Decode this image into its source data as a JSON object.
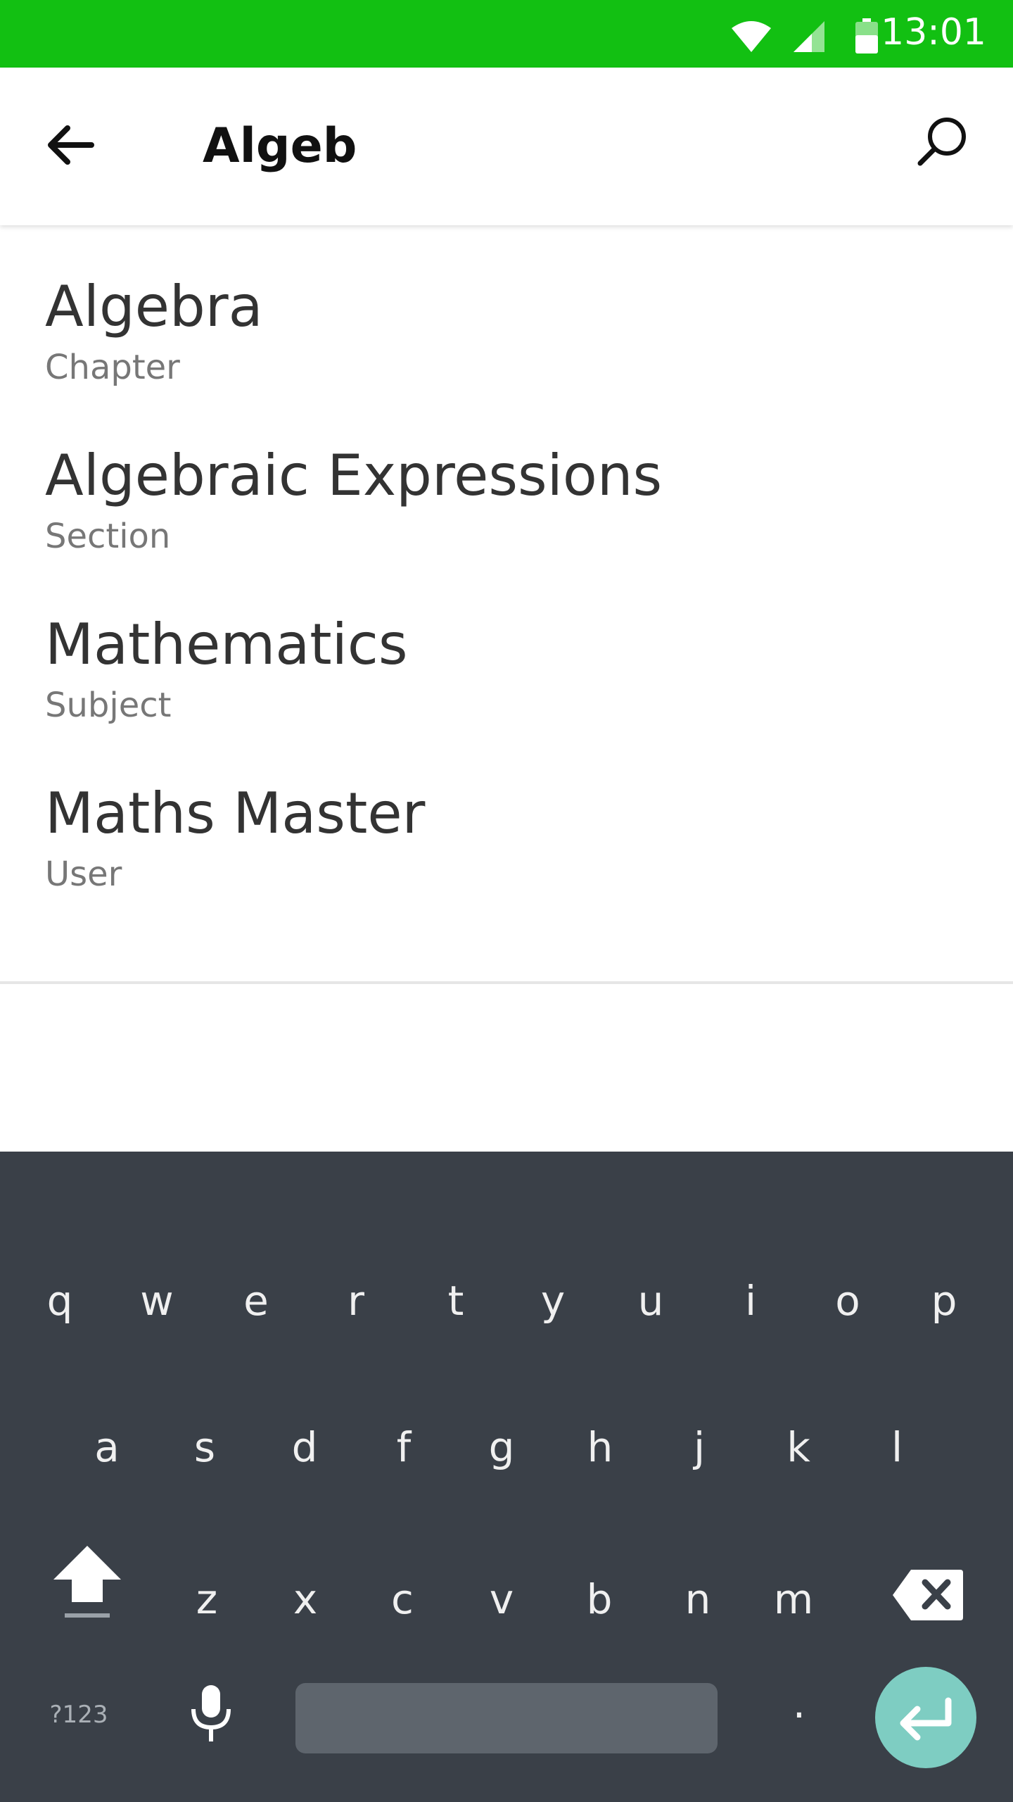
{
  "status_bar": {
    "time": "13:01",
    "background_color": "#12c012",
    "icons": [
      "wifi-icon",
      "cell-signal-icon",
      "battery-icon"
    ]
  },
  "toolbar": {
    "query": "Algeb",
    "back_icon": "arrow-left-icon",
    "search_icon": "search-icon"
  },
  "results": [
    {
      "title": "Algebra",
      "type": "Chapter"
    },
    {
      "title": "Algebraic Expressions",
      "type": "Section"
    },
    {
      "title": "Mathematics",
      "type": "Subject"
    },
    {
      "title": "Maths Master",
      "type": "User"
    }
  ],
  "keyboard": {
    "row1": [
      "q",
      "w",
      "e",
      "r",
      "t",
      "y",
      "u",
      "i",
      "o",
      "p"
    ],
    "row2": [
      "a",
      "s",
      "d",
      "f",
      "g",
      "h",
      "j",
      "k",
      "l"
    ],
    "row3": [
      "z",
      "x",
      "c",
      "v",
      "b",
      "n",
      "m"
    ],
    "symbols_label": "?123",
    "period": ".",
    "accent_color": "#7ecdc2",
    "background_color": "#3a4048"
  }
}
